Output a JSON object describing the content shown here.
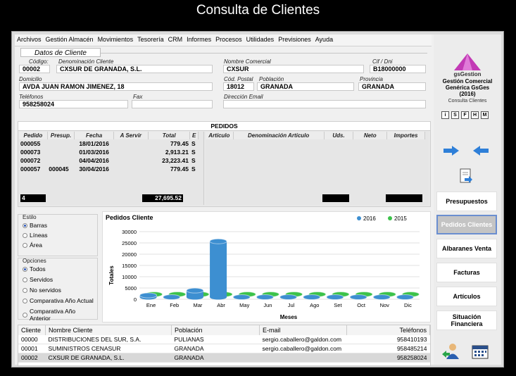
{
  "caption": "Consulta de Clientes",
  "menu": [
    "Archivos",
    "Gestión Almacén",
    "Movimientos",
    "Tesorería",
    "CRM",
    "Informes",
    "Procesos",
    "Utilidades",
    "Previsiones",
    "Ayuda"
  ],
  "client": {
    "section_title": "Datos de Cliente",
    "codigo_label": "Código:",
    "codigo": "00002",
    "denominacion_label": "Denominación Cliente",
    "denominacion": "CXSUR DE GRANADA, S.L.",
    "nombre_comercial_label": "Nombre Comercial",
    "nombre_comercial": "CXSUR",
    "cif_label": "Cif / Dni",
    "cif": "B18000000",
    "domicilio_label": "Domicilio",
    "domicilio": "AVDA JUAN RAMON JIMENEZ, 18",
    "cp_label": "Cód. Postal",
    "cp": "18012",
    "poblacion_label": "Población",
    "poblacion": "GRANADA",
    "provincia_label": "Provincia",
    "provincia": "GRANADA",
    "telefonos_label": "Teléfonos",
    "telefonos": "958258024",
    "fax_label": "Fax",
    "fax": "",
    "email_label": "Dirección Email",
    "email": ""
  },
  "pedidos": {
    "title": "PEDIDOS",
    "columns": [
      "Pedido",
      "Presup.",
      "Fecha",
      "A Servir",
      "Total",
      "E"
    ],
    "rows": [
      {
        "pedido": "000055",
        "presup": "",
        "fecha": "18/01/2016",
        "aservir": "",
        "total": "779.45",
        "e": "S"
      },
      {
        "pedido": "000073",
        "presup": "",
        "fecha": "01/03/2016",
        "aservir": "",
        "total": "2,913.21",
        "e": "S"
      },
      {
        "pedido": "000072",
        "presup": "",
        "fecha": "04/04/2016",
        "aservir": "",
        "total": "23,223.41",
        "e": "S"
      },
      {
        "pedido": "000057",
        "presup": "000045",
        "fecha": "30/04/2016",
        "aservir": "",
        "total": "779.45",
        "e": "S"
      }
    ],
    "count": "4",
    "sum_total": "27,695.52",
    "article_columns": [
      "Artículo",
      "Denominación Artículo",
      "Uds.",
      "Neto",
      "Importes"
    ]
  },
  "estilo": {
    "title": "Estilo",
    "options": [
      "Barras",
      "Líneas",
      "Área"
    ],
    "selected": 0
  },
  "opciones": {
    "title": "Opciones",
    "options": [
      "Todos",
      "Servidos",
      "No servidos",
      "Comparativa Año Actual",
      "Comparativa Año Anterior"
    ],
    "selected": 0
  },
  "chart_data": {
    "type": "bar",
    "title": "Pedidos Cliente",
    "xlabel": "Meses",
    "ylabel": "Totales",
    "categories": [
      "Ene",
      "Feb",
      "Mar",
      "Abr",
      "May",
      "Jun",
      "Jul",
      "Ago",
      "Set",
      "Oct",
      "Nov",
      "Dic"
    ],
    "series": [
      {
        "name": "2016",
        "color": "#3d8fd1",
        "values": [
          780,
          0,
          2913,
          24783,
          0,
          0,
          0,
          0,
          0,
          0,
          0,
          0
        ]
      },
      {
        "name": "2015",
        "color": "#3cc24a",
        "values": [
          0,
          0,
          0,
          0,
          0,
          0,
          0,
          0,
          0,
          0,
          0,
          0
        ]
      }
    ],
    "ylim": [
      0,
      30000
    ],
    "yticks": [
      "0",
      "5000",
      "10000",
      "15000",
      "20000",
      "25000",
      "30000"
    ],
    "legend": "top-right",
    "grid": true
  },
  "clients_table": {
    "columns": [
      "Cliente",
      "Nombre Cliente",
      "Población",
      "E-mail",
      "Teléfonos"
    ],
    "rows": [
      {
        "cliente": "00000",
        "nombre": "DISTRIBUCIONES DEL SUR, S.A.",
        "poblacion": "PULIANAS",
        "email": "sergio.caballero@galdon.com",
        "telefonos": "958410193"
      },
      {
        "cliente": "00001",
        "nombre": "SUMINISTROS CENASUR",
        "poblacion": "GRANADA",
        "email": "sergio.caballero@galdon.com",
        "telefonos": "958485214"
      },
      {
        "cliente": "00002",
        "nombre": "CXSUR DE GRANADA, S.L.",
        "poblacion": "GRANADA",
        "email": "",
        "telefonos": "958258024"
      }
    ]
  },
  "sidebar": {
    "brand": "gsGestion",
    "product_line1": "Gestión Comercial",
    "product_line2": "Genérica GsGes",
    "year": "(2016)",
    "subtitle": "Consulta Clientes",
    "small_icons": [
      "i",
      "S",
      "F",
      "H",
      "M"
    ],
    "buttons": [
      "Presupuestos",
      "Pedidos Clientes",
      "Albaranes Venta",
      "Facturas",
      "Artículos",
      "Situación Financiera"
    ],
    "active_index": 1,
    "brand_color": "#c23ab5"
  }
}
